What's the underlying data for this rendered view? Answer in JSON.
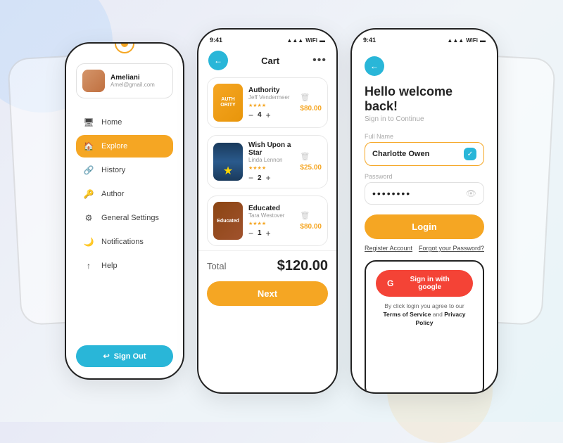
{
  "background": {
    "color": "#eef2f7"
  },
  "phone1": {
    "profile": {
      "name": "Ameliani",
      "email": "Amel@gmail.com"
    },
    "nav": [
      {
        "id": "home",
        "label": "Home",
        "icon": "🖥",
        "active": false
      },
      {
        "id": "explore",
        "label": "Explore",
        "icon": "🏠",
        "active": true
      },
      {
        "id": "history",
        "label": "History",
        "icon": "🔗",
        "active": false
      },
      {
        "id": "author",
        "label": "Author",
        "icon": "🔑",
        "active": false
      },
      {
        "id": "settings",
        "label": "General Settings",
        "icon": "⚙",
        "active": false
      },
      {
        "id": "notifications",
        "label": "Notifications",
        "icon": "🌙",
        "active": false
      },
      {
        "id": "help",
        "label": "Help",
        "icon": "↑",
        "active": false
      }
    ],
    "sign_out_label": "Sign Out"
  },
  "phone2": {
    "status_time": "9:41",
    "header_title": "Cart",
    "more_icon": "•••",
    "items": [
      {
        "title": "Authority",
        "author": "Jeff Vendermeer",
        "stars": "★★★★",
        "qty": 4,
        "price": "$80.00",
        "cover_text": "AUTH ORITY"
      },
      {
        "title": "Wish Upon a Star",
        "author": "Linda Lennon",
        "stars": "★★★★",
        "qty": 2,
        "price": "$25.00",
        "cover_text": "★"
      },
      {
        "title": "Educated",
        "author": "Tara Westover",
        "stars": "★★★★",
        "qty": 1,
        "price": "$80.00",
        "cover_text": "Educated"
      }
    ],
    "total_label": "Total",
    "total_amount": "$120.00",
    "next_btn_label": "Next"
  },
  "phone3": {
    "status_time": "9:41",
    "welcome_title": "Hello welcome back!",
    "welcome_subtitle": "Sign in to Continue",
    "full_name_label": "Full Name",
    "full_name_value": "Charlotte Owen",
    "password_label": "Password",
    "password_value": "••••••••",
    "login_btn_label": "Login",
    "register_label": "Register Account",
    "forgot_label": "Forgot your Password?",
    "google_btn_label": "Sign in with google",
    "terms_text": "By click login you agree to our Terms of Service and Privacy Policy"
  }
}
